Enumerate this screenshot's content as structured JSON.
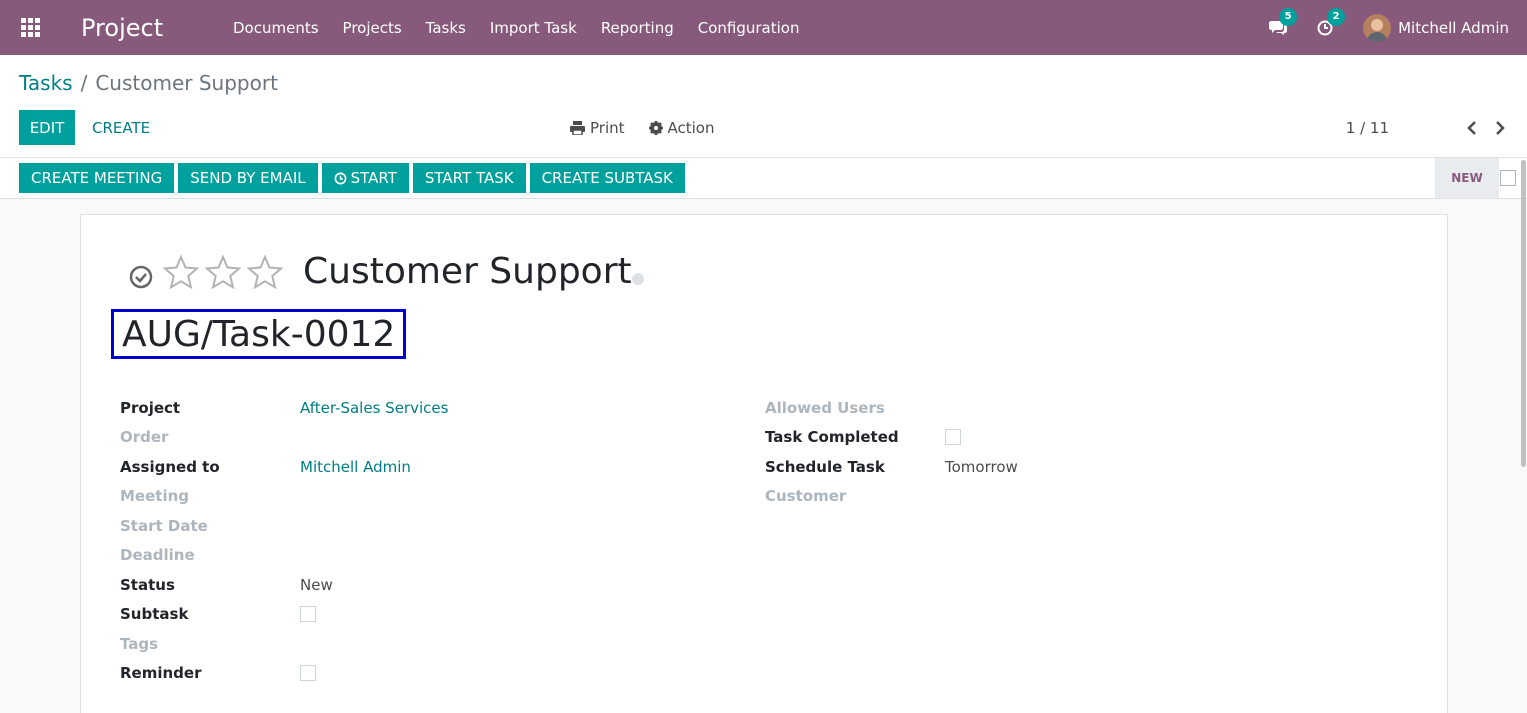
{
  "navbar": {
    "app_name": "Project",
    "menu": [
      "Documents",
      "Projects",
      "Tasks",
      "Import Task",
      "Reporting",
      "Configuration"
    ],
    "messages_count": "5",
    "activities_count": "2",
    "user_name": "Mitchell Admin",
    "bg_color": "#875a7b"
  },
  "breadcrumb": {
    "parent": "Tasks",
    "separator": "/",
    "current": "Customer Support"
  },
  "toolbar": {
    "edit_label": "EDIT",
    "create_label": "CREATE",
    "print_label": "Print",
    "action_label": "Action",
    "pager": "1 / 11"
  },
  "statusbar": {
    "buttons": [
      "CREATE MEETING",
      "SEND BY EMAIL",
      "START",
      "START TASK",
      "CREATE SUBTASK"
    ],
    "stage": "NEW",
    "accent_color": "#00a09d"
  },
  "form": {
    "title": "Customer Support",
    "reference": "AUG/Task-0012",
    "priority_stars": 3,
    "left_fields": [
      {
        "label": "Project",
        "value": "After-Sales Services",
        "style": "bold",
        "type": "link"
      },
      {
        "label": "Order",
        "value": "",
        "style": "muted",
        "type": "text"
      },
      {
        "label": "Assigned to",
        "value": "Mitchell Admin",
        "style": "bold",
        "type": "link"
      },
      {
        "label": "Meeting",
        "value": "",
        "style": "muted",
        "type": "text"
      },
      {
        "label": "Start Date",
        "value": "",
        "style": "muted",
        "type": "text"
      },
      {
        "label": "Deadline",
        "value": "",
        "style": "muted",
        "type": "text"
      },
      {
        "label": "Status",
        "value": "New",
        "style": "bold",
        "type": "text"
      },
      {
        "label": "Subtask",
        "value": "",
        "style": "bold",
        "type": "checkbox"
      },
      {
        "label": "Tags",
        "value": "",
        "style": "muted",
        "type": "text"
      },
      {
        "label": "Reminder",
        "value": "",
        "style": "bold",
        "type": "checkbox"
      }
    ],
    "right_fields": [
      {
        "label": "Allowed Users",
        "value": "",
        "style": "muted",
        "type": "text"
      },
      {
        "label": "Task Completed",
        "value": "",
        "style": "bold",
        "type": "checkbox"
      },
      {
        "label": "Schedule Task",
        "value": "Tomorrow",
        "style": "bold",
        "type": "text"
      },
      {
        "label": "Customer",
        "value": "",
        "style": "muted",
        "type": "text"
      }
    ]
  }
}
